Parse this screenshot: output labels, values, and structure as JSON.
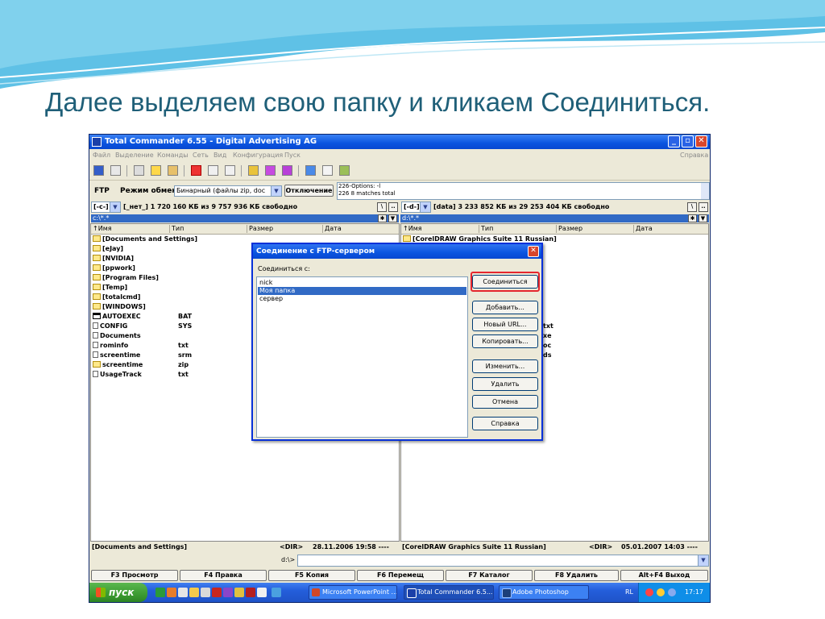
{
  "slide": {
    "title": "Далее выделяем свою папку и кликаем Соединиться."
  },
  "window": {
    "title": "Total Commander 6.55 - Digital Advertising AG",
    "buttons": {
      "minimize": "_",
      "restore": "▫",
      "close": "✕"
    }
  },
  "menu": {
    "items": [
      "Файл",
      "Выделение",
      "Команды",
      "Сеть",
      "Вид",
      "Конфигурация",
      "Пуск"
    ],
    "help": "Справка"
  },
  "ftpbar": {
    "ftp_label": "FTP",
    "mode_label": "Режим обмена",
    "mode_value": "Бинарный (файлы zip, doc",
    "disconnect_button": "Отключение",
    "log_lines": [
      "226-Options: -l",
      "226 8 matches total"
    ]
  },
  "left_panel": {
    "drive": "[-c-]",
    "drive_info": "[_нет_]  1 720 160 КБ из 9 757 936 КБ свободно",
    "path": "c:\\*.*",
    "nav_root": "\\",
    "nav_up": "..",
    "columns": [
      "↑Имя",
      "Тип",
      "Размер",
      "Дата"
    ],
    "rows": [
      {
        "name": "[Documents and Settings]",
        "ext": "",
        "kind": "folder"
      },
      {
        "name": "[eJay]",
        "ext": "",
        "kind": "folder"
      },
      {
        "name": "[NVIDIA]",
        "ext": "",
        "kind": "folder"
      },
      {
        "name": "[ppwork]",
        "ext": "",
        "kind": "folder"
      },
      {
        "name": "[Program Files]",
        "ext": "",
        "kind": "folder"
      },
      {
        "name": "[Temp]",
        "ext": "",
        "kind": "folder"
      },
      {
        "name": "[totalcmd]",
        "ext": "",
        "kind": "folder"
      },
      {
        "name": "[WINDOWS]",
        "ext": "",
        "kind": "folder"
      },
      {
        "name": "AUTOEXEC",
        "ext": "BAT",
        "kind": "exe"
      },
      {
        "name": "CONFIG",
        "ext": "SYS",
        "kind": "file"
      },
      {
        "name": "Documents",
        "ext": "",
        "kind": "file"
      },
      {
        "name": "rominfo",
        "ext": "txt",
        "kind": "file"
      },
      {
        "name": "screentime",
        "ext": "srm",
        "kind": "file"
      },
      {
        "name": "screentime",
        "ext": "zip",
        "kind": "folder"
      },
      {
        "name": "UsageTrack",
        "ext": "txt",
        "kind": "file"
      }
    ],
    "status": "[Documents and Settings]",
    "status_dir": "<DIR>",
    "status_date": "28.11.2006 19:58 ----"
  },
  "right_panel": {
    "drive": "[-d-]",
    "drive_info": "[data]  3 233 852 КБ из 29 253 404 КБ свободно",
    "path": "d:\\*.*",
    "nav_root": "\\",
    "nav_up": "..",
    "columns": [
      "↑Имя",
      "Тип",
      "Размер",
      "Дата"
    ],
    "first_row": "[CorelDRAW Graphics Suite 11 Russian]",
    "partial_ext": [
      "txt",
      "xe",
      "oc",
      "ds"
    ],
    "status": "[CorelDRAW Graphics Suite 11 Russian]",
    "status_dir": "<DIR>",
    "status_date": "05.01.2007 14:03 ----"
  },
  "cmdline": {
    "prompt": "d:\\>"
  },
  "fkeys": [
    "F3 Просмотр",
    "F4 Правка",
    "F5 Копия",
    "F6 Перемещ",
    "F7 Каталог",
    "F8 Удалить",
    "Alt+F4 Выход"
  ],
  "dialog": {
    "title": "Соединение с FTP-сервером",
    "close": "✕",
    "label": "Соединиться с:",
    "items": [
      "nick",
      "Моя папка",
      "сервер"
    ],
    "selected_index": 1,
    "buttons": {
      "connect": "Соединиться",
      "add": "Добавить...",
      "new_url": "Новый URL...",
      "copy": "Копировать...",
      "edit": "Изменить...",
      "delete": "Удалить",
      "cancel": "Отмена",
      "help": "Справка"
    }
  },
  "taskbar": {
    "start": "пуск",
    "tasks": [
      "Microsoft PowerPoint ...",
      "Total Commander 6.5...",
      "Adobe Photoshop"
    ],
    "active_index": 1,
    "lang": "RL",
    "clock": "17:17"
  },
  "colors": {
    "slide_title": "#1f5f78",
    "xp_title_blue": "#0a54e0",
    "selection_blue": "#316ac5",
    "highlight_red": "#e5262e",
    "start_green": "#3c9b31"
  }
}
